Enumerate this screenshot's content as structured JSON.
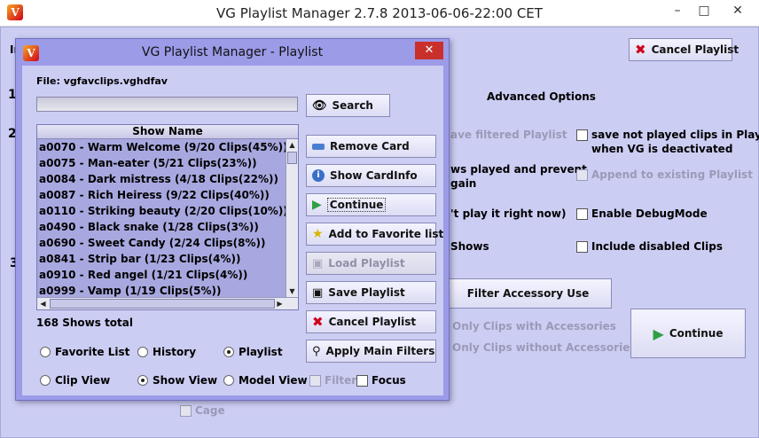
{
  "main": {
    "title": "VG Playlist Manager 2.7.8 2013-06-06-22:00 CET",
    "window_controls": {
      "minimize": "–",
      "maximize": "□",
      "close": "✕"
    },
    "cancel_playlist_label": "Cancel Playlist",
    "fragment_labels": {
      "in": "In",
      "step1": "1",
      "step2": "2",
      "step3": "3"
    },
    "advanced_options_label": "Advanced Options",
    "options": {
      "save_filtered": "ave filtered Playlist",
      "save_not_played": "save not played clips in Playlist",
      "save_not_played_line2": "when VG is deactivated",
      "shows_played_line1": "ws played and prevent",
      "shows_played_line2": "gain",
      "append_existing": "Append to existing Playlist",
      "play_right_now": "'t play it right now)",
      "enable_debug": "Enable DebugMode",
      "shows": "Shows",
      "include_disabled": "Include disabled Clips"
    },
    "filter_accessory_label": "Filter Accessory Use",
    "only_with_accessories": "Only Clips with Accessories",
    "only_without_accessories": "Only Clips without Accessories",
    "continue_label": "Continue",
    "cage_label": "Cage"
  },
  "dialog": {
    "title": "VG Playlist Manager - Playlist",
    "close_symbol": "✕",
    "file_label": "File: vgfavclips.vghdfav",
    "search_label": "Search",
    "list_header": "Show Name",
    "list_items": [
      "a0070 - Warm Welcome (9/20 Clips(45%))",
      "a0075 - Man-eater (5/21 Clips(23%))",
      "a0084 - Dark mistress (4/18 Clips(22%))",
      "a0087 - Rich Heiress (9/22 Clips(40%))",
      "a0110 - Striking beauty (2/20 Clips(10%))",
      "a0490 - Black snake (1/28 Clips(3%))",
      "a0690 - Sweet Candy (2/24 Clips(8%))",
      "a0841 - Strip bar (1/23 Clips(4%))",
      "a0910 - Red angel (1/21 Clips(4%))",
      "a0999 - Vamp (1/19 Clips(5%))"
    ],
    "total_label": "168 Shows total",
    "buttons": {
      "remove_card": "Remove Card",
      "show_cardinfo": "Show CardInfo",
      "continue": "Continue",
      "add_favorite": "Add to Favorite list",
      "load_playlist": "Load Playlist",
      "save_playlist": "Save Playlist",
      "cancel_playlist": "Cancel Playlist",
      "apply_filters": "Apply Main Filters"
    },
    "radios": {
      "favorite_list": "Favorite List",
      "history": "History",
      "playlist": "Playlist",
      "clip_view": "Clip View",
      "show_view": "Show View",
      "model_view": "Model View"
    },
    "checks": {
      "filter": "Filter",
      "focus": "Focus"
    }
  },
  "colors": {
    "accent_red": "#c9302c",
    "accent_green": "#2ea043",
    "panel_bg": "#cccdf3",
    "dialog_frame": "#9b9be8"
  }
}
